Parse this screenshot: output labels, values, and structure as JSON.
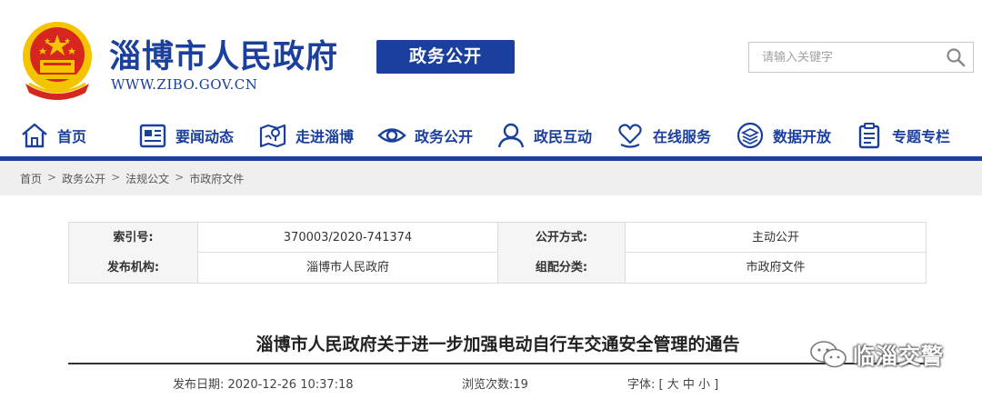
{
  "header": {
    "site_title": "淄博市人民政府",
    "site_url": "WWW.ZIBO.GOV.CN",
    "section_badge": "政务公开",
    "search": {
      "placeholder": "请输入关键字",
      "value": ""
    }
  },
  "nav": {
    "items": [
      {
        "label": "首页",
        "icon": "home-icon"
      },
      {
        "label": "要闻动态",
        "icon": "news-icon"
      },
      {
        "label": "走进淄博",
        "icon": "map-icon"
      },
      {
        "label": "政务公开",
        "icon": "eye-icon"
      },
      {
        "label": "政民互动",
        "icon": "people-icon"
      },
      {
        "label": "在线服务",
        "icon": "heart-hand-icon"
      },
      {
        "label": "数据开放",
        "icon": "layers-icon"
      },
      {
        "label": "专题专栏",
        "icon": "document-icon"
      }
    ]
  },
  "breadcrumb": [
    "首页",
    "政务公开",
    "法规公文",
    "市政府文件"
  ],
  "breadcrumb_sep": ">",
  "meta": {
    "index_label": "索引号:",
    "index_value": "370003/2020-741374",
    "publicity_label": "公开方式:",
    "publicity_value": "主动公开",
    "issuer_label": "发布机构:",
    "issuer_value": "淄博市人民政府",
    "category_label": "组配分类:",
    "category_value": "市政府文件"
  },
  "article": {
    "title": "淄博市人民政府关于进一步加强电动自行车交通安全管理的通告",
    "publish_date": "发布日期: 2020-12-26 10:37:18",
    "views": "浏览次数:19",
    "font_size": "字体: [ 大 中 小 ]"
  },
  "watermark": {
    "text": "临淄交警",
    "icon": "wechat-icon"
  },
  "colors": {
    "brand": "#1a3f9c",
    "emblem_red": "#d7261e",
    "emblem_gold": "#f5c400"
  }
}
